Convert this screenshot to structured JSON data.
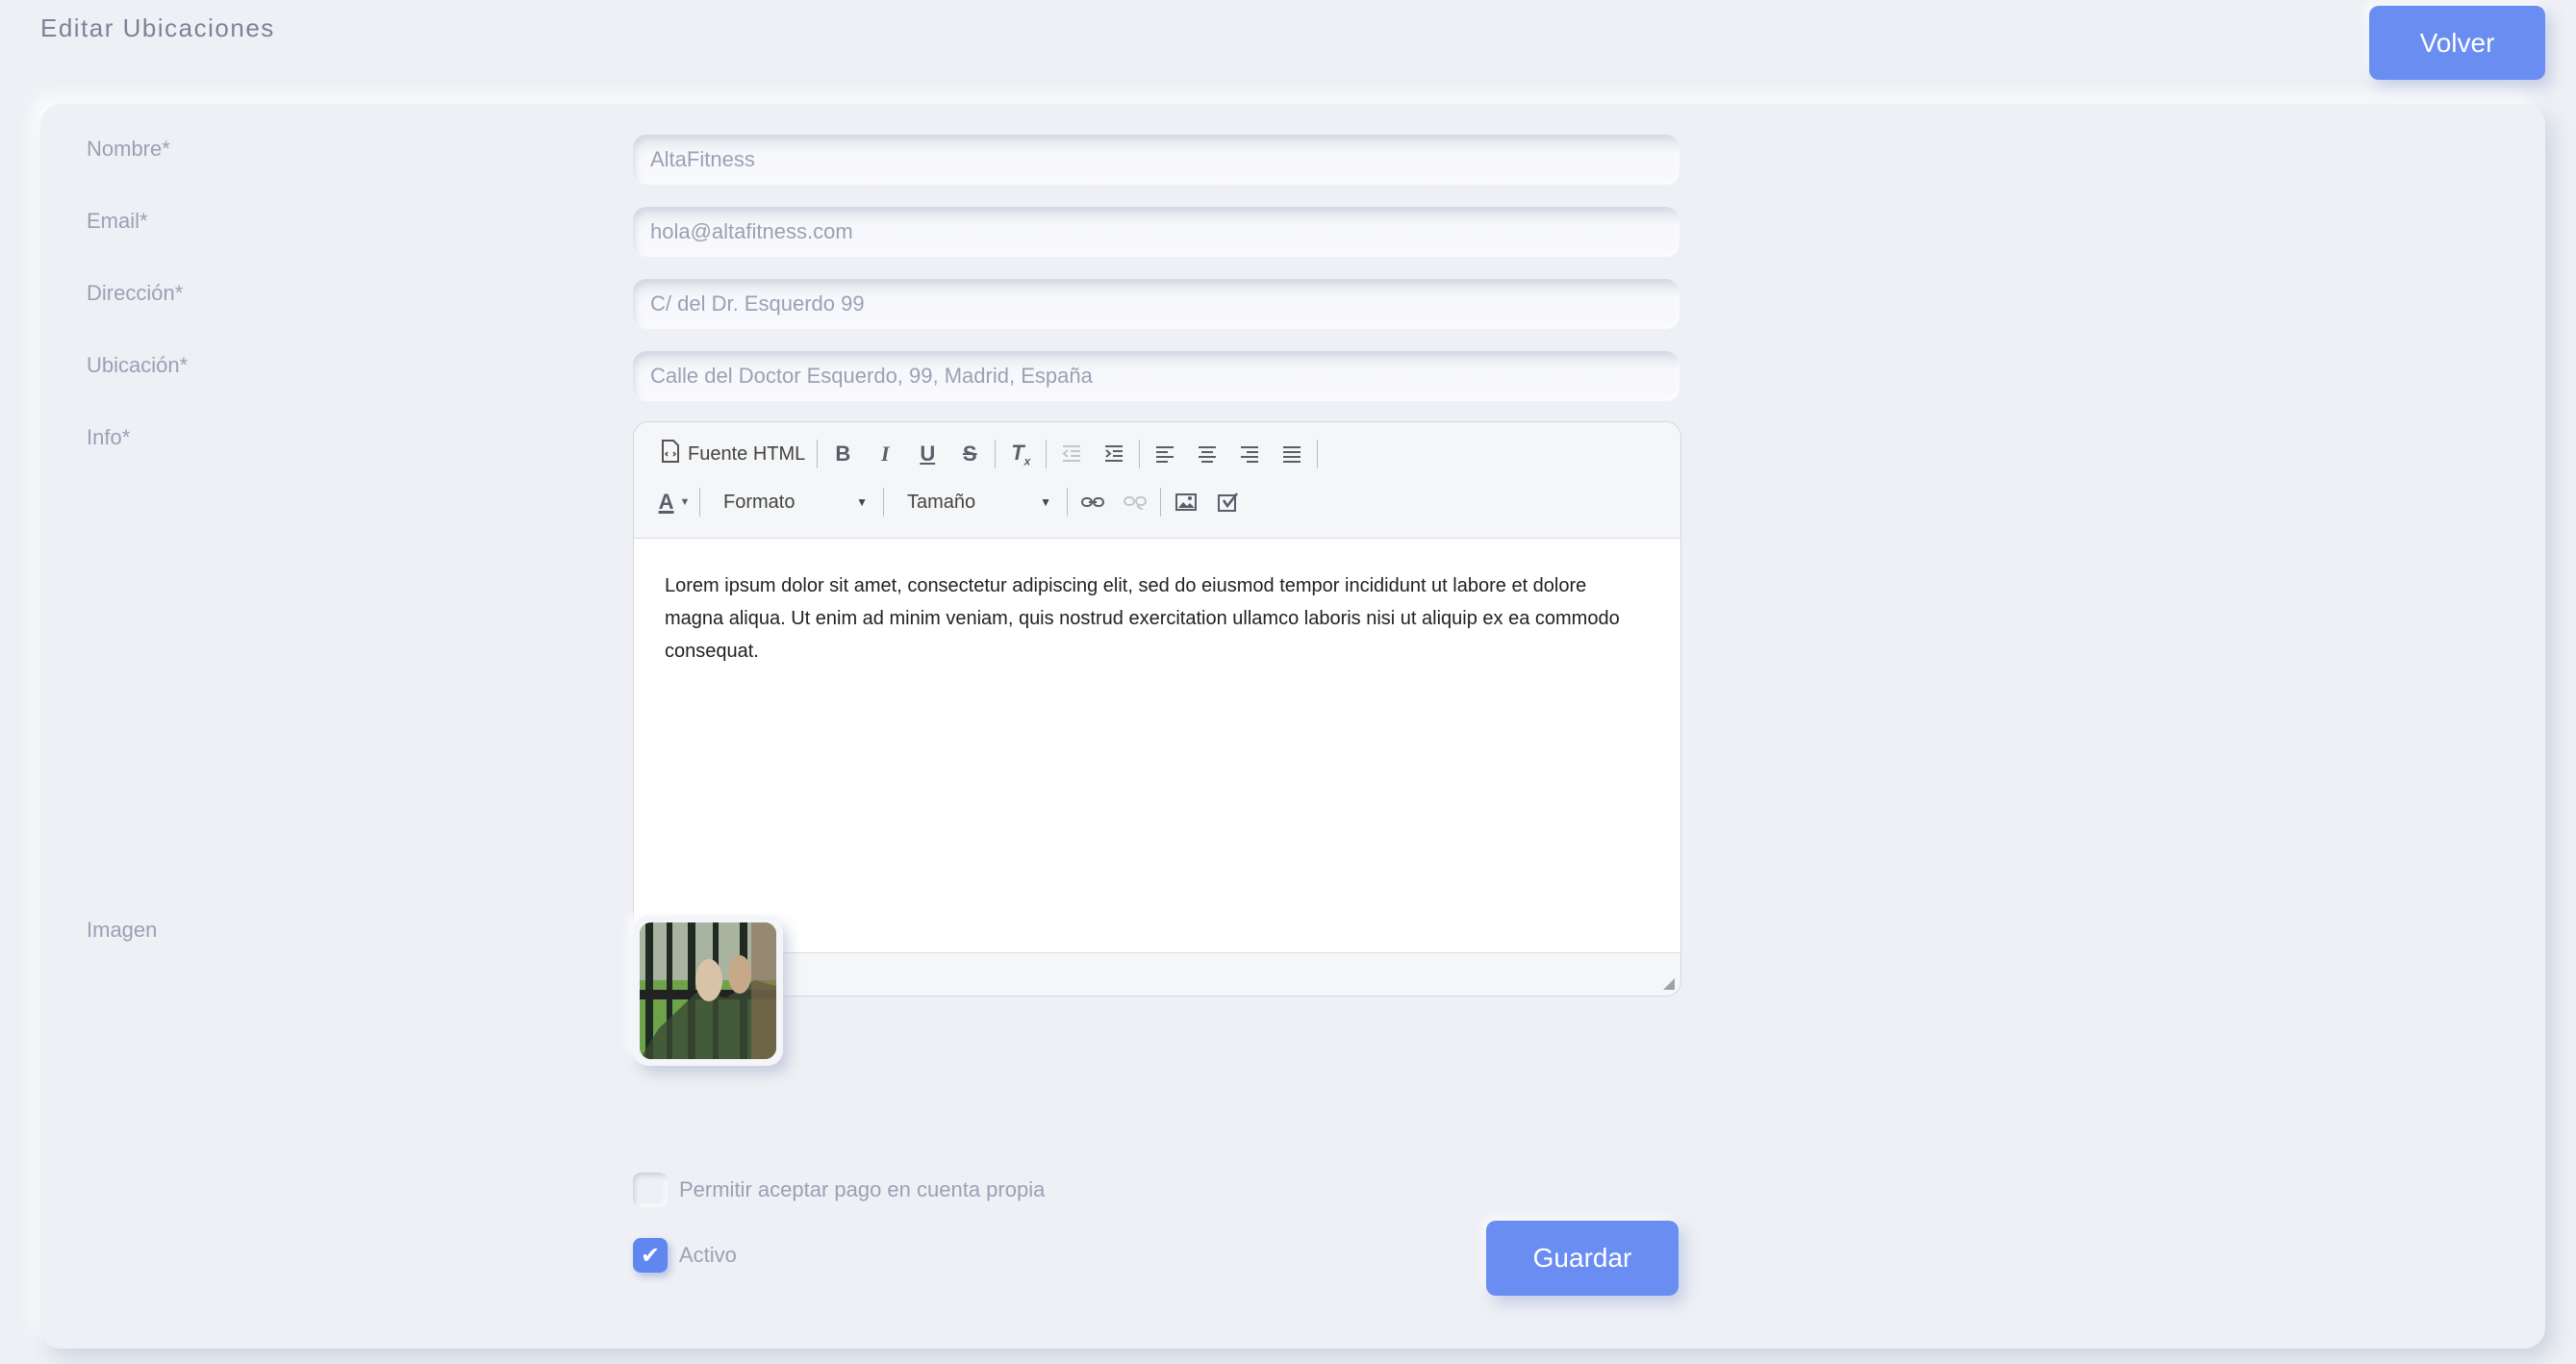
{
  "header": {
    "title": "Editar Ubicaciones",
    "back_button": "Volver"
  },
  "form": {
    "fields": {
      "nombre": {
        "label": "Nombre*",
        "value": "AltaFitness"
      },
      "email": {
        "label": "Email*",
        "value": "hola@altafitness.com"
      },
      "direccion": {
        "label": "Dirección*",
        "value": "C/ del Dr. Esquerdo 99"
      },
      "ubicacion": {
        "label": "Ubicación*",
        "value": "Calle del Doctor Esquerdo, 99, Madrid, España"
      }
    },
    "info": {
      "label": "Info*",
      "toolbar": {
        "source_label": "Fuente HTML",
        "format_label": "Formato",
        "size_label": "Tamaño",
        "buttons": [
          "bold",
          "italic",
          "underline",
          "strikethrough",
          "remove-format",
          "outdent",
          "indent",
          "align-left",
          "align-center",
          "align-right",
          "align-justify",
          "text-color",
          "link",
          "unlink",
          "image",
          "embed"
        ]
      },
      "content": "Lorem ipsum dolor sit amet, consectetur adipiscing elit, sed do eiusmod tempor incididunt ut labore et dolore magna aliqua. Ut enim ad minim veniam, quis nostrud exercitation ullamco laboris nisi ut aliquip ex ea commodo consequat."
    },
    "image": {
      "label": "Imagen"
    },
    "checkboxes": {
      "own_account": {
        "label": "Permitir aceptar pago en cuenta propia",
        "checked": false
      },
      "active": {
        "label": "Activo",
        "checked": true
      }
    },
    "save_button": "Guardar"
  },
  "colors": {
    "accent": "#6a8df2",
    "background": "#eef0f5",
    "label_text": "#9aa1b5"
  }
}
